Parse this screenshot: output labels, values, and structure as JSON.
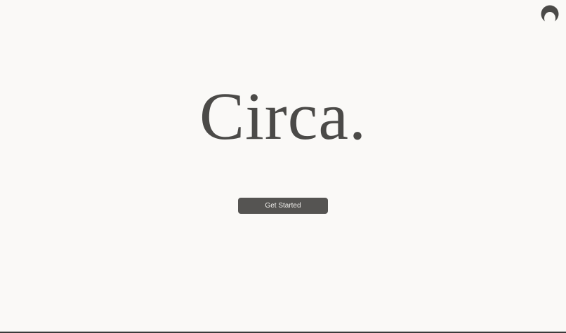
{
  "brand": {
    "title": "Circa.",
    "logo_icon": "half-moon-logo-icon",
    "text_color": "#4b4a48"
  },
  "actions": {
    "get_started_label": "Get Started",
    "button_color": "#555452"
  },
  "theme": {
    "background": "#faf9f7"
  }
}
